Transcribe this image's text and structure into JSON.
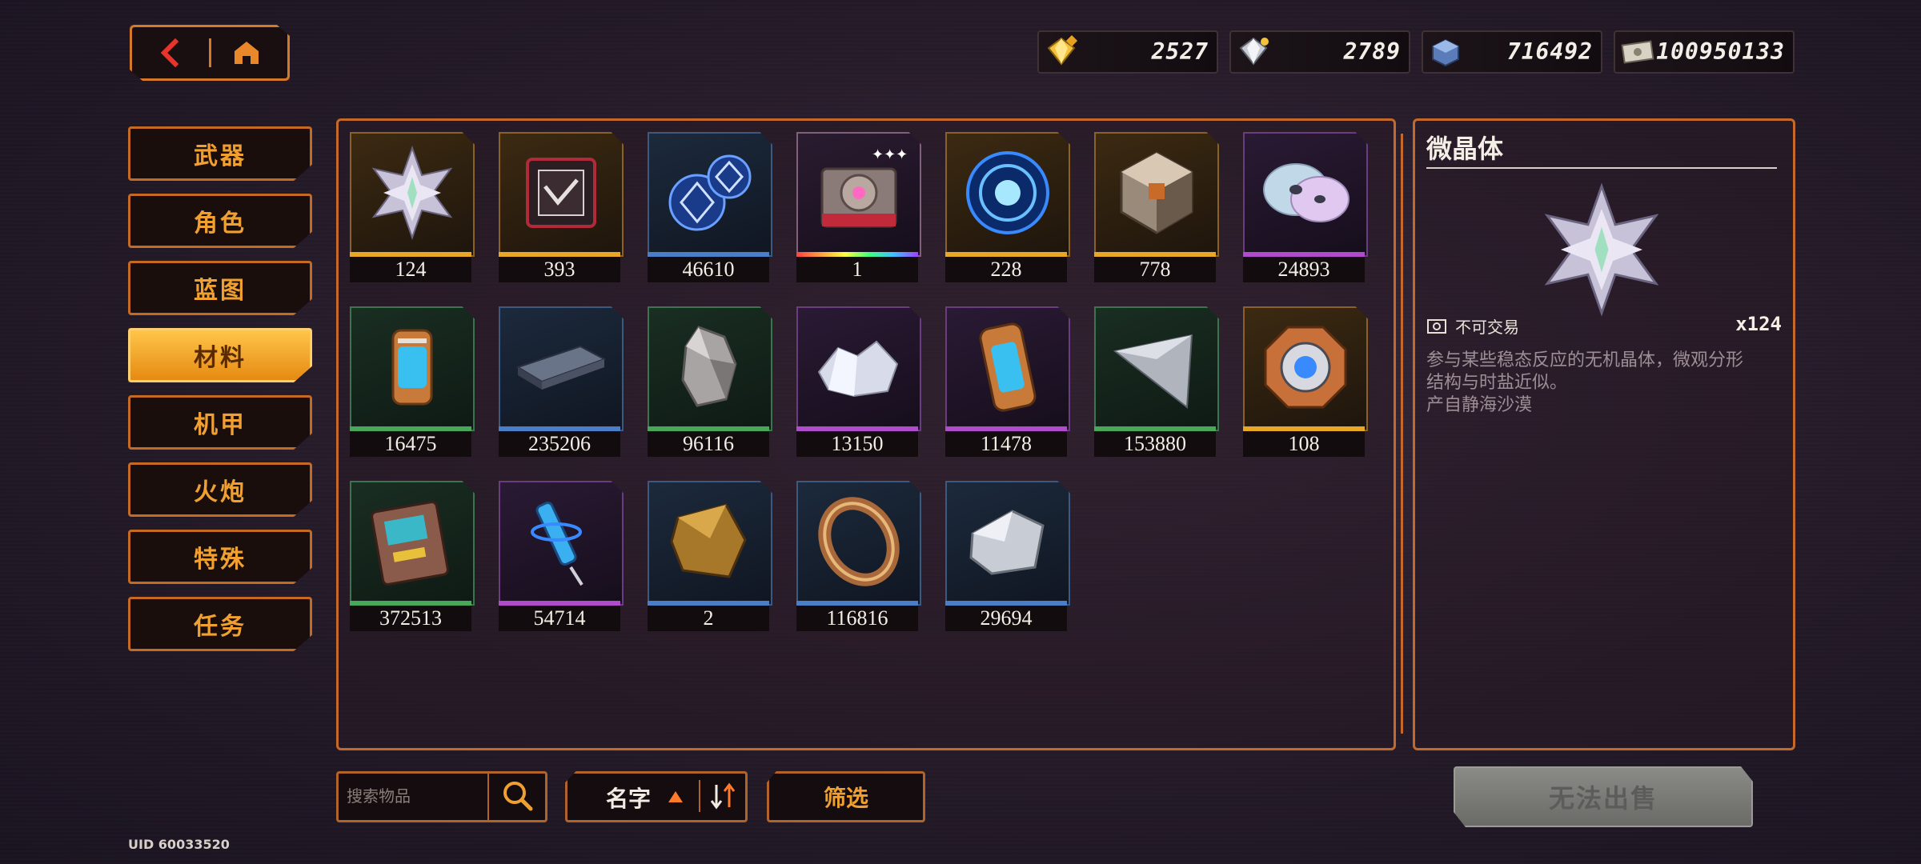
{
  "nav": {
    "back_icon": "chevron-left-icon",
    "home_icon": "home-icon"
  },
  "currencies": [
    {
      "name": "gold-gem-currency",
      "value": "2527",
      "icon": "gold-gem-icon"
    },
    {
      "name": "silver-gem-currency",
      "value": "2789",
      "icon": "silver-gem-icon"
    },
    {
      "name": "blue-crate-currency",
      "value": "716492",
      "icon": "crate-icon"
    },
    {
      "name": "cash-currency",
      "value": "100950133",
      "icon": "banknote-icon"
    }
  ],
  "tabs": [
    {
      "label": "武器",
      "active": false
    },
    {
      "label": "角色",
      "active": false
    },
    {
      "label": "蓝图",
      "active": false
    },
    {
      "label": "材料",
      "active": true
    },
    {
      "label": "机甲",
      "active": false
    },
    {
      "label": "火炮",
      "active": false
    },
    {
      "label": "特殊",
      "active": false
    },
    {
      "label": "任务",
      "active": false
    }
  ],
  "items": [
    {
      "count": "124",
      "rarity": "orange",
      "art": "crystal-star",
      "selected": true
    },
    {
      "count": "393",
      "rarity": "orange",
      "art": "chip"
    },
    {
      "count": "46610",
      "rarity": "blue",
      "art": "blue-dice"
    },
    {
      "count": "1",
      "rarity": "rainbow",
      "art": "gear-box"
    },
    {
      "count": "228",
      "rarity": "orange",
      "art": "blue-core"
    },
    {
      "count": "778",
      "rarity": "orange",
      "art": "metal-cube"
    },
    {
      "count": "24893",
      "rarity": "purple",
      "art": "discs"
    },
    {
      "count": "16475",
      "rarity": "green",
      "art": "canister"
    },
    {
      "count": "235206",
      "rarity": "blue",
      "art": "plate"
    },
    {
      "count": "96116",
      "rarity": "green",
      "art": "ore"
    },
    {
      "count": "13150",
      "rarity": "purple",
      "art": "crystal-cluster"
    },
    {
      "count": "11478",
      "rarity": "purple",
      "art": "capsule"
    },
    {
      "count": "153880",
      "rarity": "green",
      "art": "sheet"
    },
    {
      "count": "108",
      "rarity": "orange",
      "art": "octagon-core"
    },
    {
      "count": "372513",
      "rarity": "green",
      "art": "circuit-board"
    },
    {
      "count": "54714",
      "rarity": "purple",
      "art": "injector"
    },
    {
      "count": "2",
      "rarity": "blue",
      "art": "amber-rock"
    },
    {
      "count": "116816",
      "rarity": "blue",
      "art": "ring"
    },
    {
      "count": "29694",
      "rarity": "blue",
      "art": "silver-rock"
    }
  ],
  "detail": {
    "title": "微晶体",
    "tradable_label": "不可交易",
    "quantity": "x124",
    "desc_line1": "参与某些稳态反应的无机晶体，微观分形",
    "desc_line2": "结构与时盐近似。",
    "desc_line3": "产自静海沙漠"
  },
  "controls": {
    "search_placeholder": "搜索物品",
    "sort_label": "名字",
    "filter_label": "筛选",
    "sell_label": "无法出售"
  },
  "uid": "UID 60033520"
}
